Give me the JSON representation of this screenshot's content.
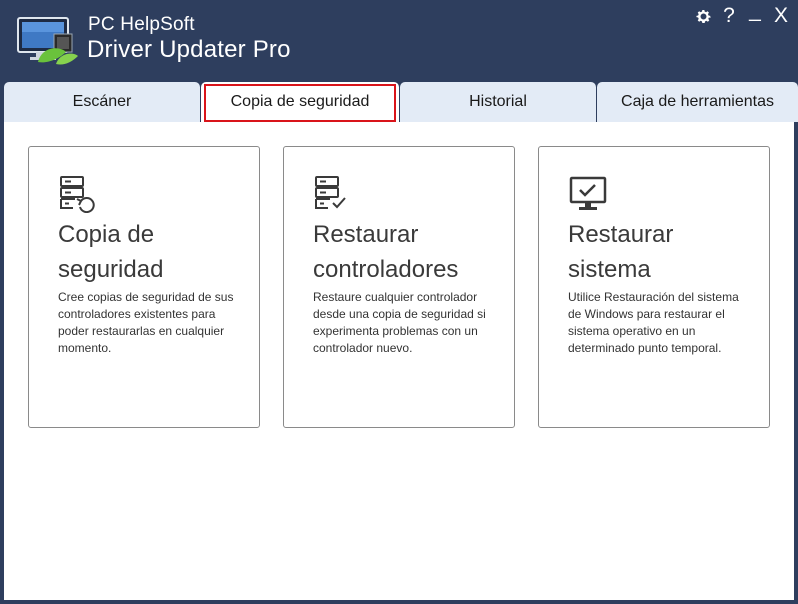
{
  "header": {
    "brand_top": "PC HelpSoft",
    "brand_bottom": "Driver Updater Pro",
    "settings_icon": "gear-icon",
    "help_label": "?",
    "minimize_label": "_",
    "close_label": "X"
  },
  "tabs": [
    {
      "label": "Escáner",
      "active": false
    },
    {
      "label": "Copia de seguridad",
      "active": true
    },
    {
      "label": "Historial",
      "active": false
    },
    {
      "label": "Caja de herramientas",
      "active": false
    }
  ],
  "cards": [
    {
      "icon": "backup-server-icon",
      "title_line1": "Copia de",
      "title_line2": "seguridad",
      "description": "Cree copias de seguridad de sus controladores existentes para poder restaurarlas en cualquier momento."
    },
    {
      "icon": "restore-drivers-icon",
      "title_line1": "Restaurar",
      "title_line2": "controladores",
      "description": "Restaure cualquier controlador desde una copia de seguridad si experimenta problemas con un controlador nuevo."
    },
    {
      "icon": "monitor-check-icon",
      "title_line1": "Restaurar",
      "title_line2": "sistema",
      "description": "Utilice Restauración del sistema de Windows para restaurar el sistema operativo en un determinado punto temporal."
    }
  ],
  "colors": {
    "background": "#2e3e5e",
    "tab_inactive": "#e3ebf6",
    "tab_active": "#ffffff",
    "highlight": "#d9141a",
    "card_border": "#8a8a8a"
  }
}
